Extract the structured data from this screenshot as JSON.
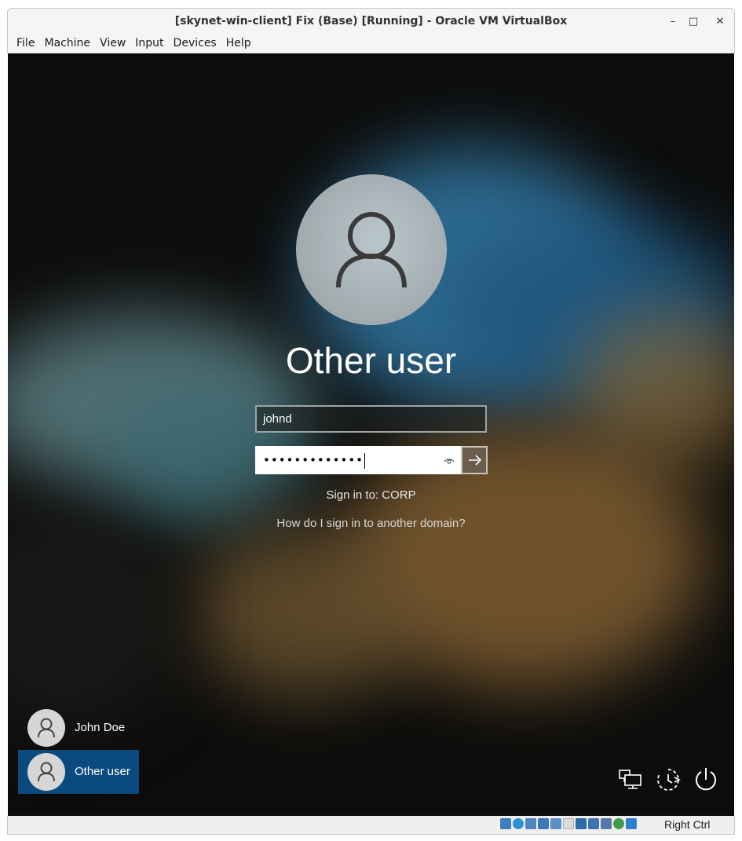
{
  "window": {
    "title": "[skynet-win-client] Fix (Base) [Running] - Oracle VM VirtualBox",
    "minimize_glyph": "–",
    "maximize_glyph": "□",
    "close_glyph": "✕"
  },
  "menubar": {
    "items": [
      {
        "label": "File"
      },
      {
        "label": "Machine"
      },
      {
        "label": "View"
      },
      {
        "label": "Input"
      },
      {
        "label": "Devices"
      },
      {
        "label": "Help"
      }
    ]
  },
  "login": {
    "heading": "Other user",
    "username_value": "johnd",
    "password_mask": "•••••••••••••",
    "sign_in_to": "Sign in to: CORP",
    "domain_help_link": "How do I sign in to another domain?",
    "icons": {
      "avatar": "user-avatar-icon",
      "reveal": "eye-icon",
      "submit": "arrow-right-icon"
    }
  },
  "user_list": [
    {
      "name": "John Doe",
      "selected": false
    },
    {
      "name": "Other user",
      "selected": true
    }
  ],
  "corner_buttons": {
    "network": "network-icon",
    "accessibility": "ease-of-access-icon",
    "power": "power-icon"
  },
  "statusbar": {
    "host_key": "Right Ctrl",
    "icons": [
      "hard-disk-icon",
      "optical-drive-icon",
      "audio-icon",
      "network-adapter-icon",
      "usb-icon",
      "shared-folders-icon",
      "display-icon",
      "video-capture-icon",
      "cpu-icon",
      "mouse-integration-icon",
      "keyboard-capture-icon"
    ]
  },
  "colors": {
    "selected_tile": "#0b4a7e",
    "submit_button": "#6b5c4c"
  }
}
